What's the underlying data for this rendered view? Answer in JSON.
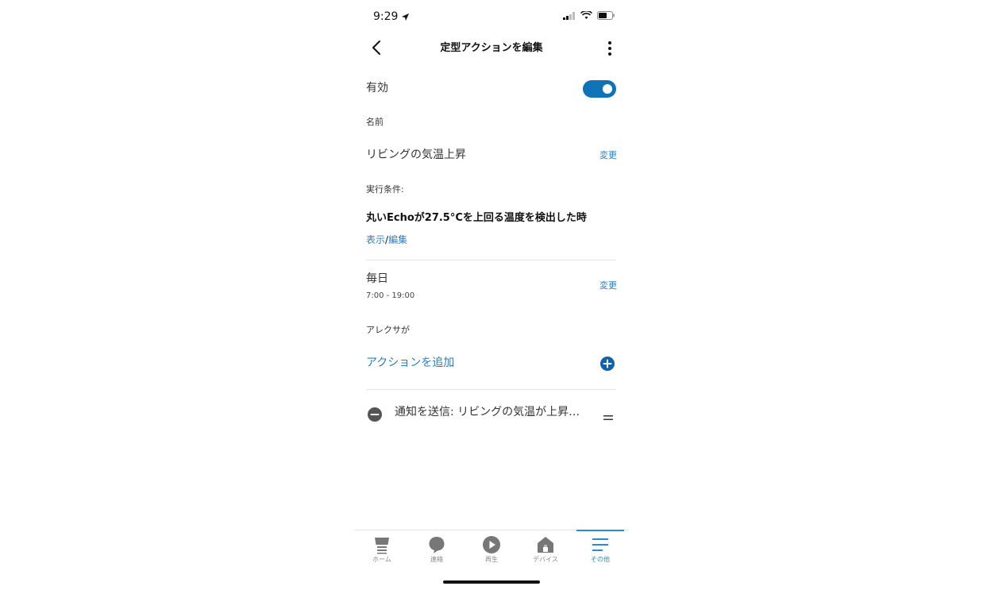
{
  "status_bar": {
    "time": "9:29"
  },
  "header": {
    "title": "定型アクションを編集"
  },
  "enabled": {
    "label": "有効",
    "on": true
  },
  "name_section": {
    "label": "名前",
    "value": "リビングの気温上昇",
    "change": "変更"
  },
  "condition": {
    "label": "実行条件:",
    "text": "丸いEchoが27.5°Cを上回る温度を検出した時",
    "view": "表示",
    "sep": "/",
    "edit": "編集"
  },
  "schedule": {
    "title": "毎日",
    "time": "7:00 - 19:00",
    "change": "変更"
  },
  "alexa": {
    "label": "アレクサが",
    "add_action": "アクションを追加"
  },
  "actions": [
    {
      "text": "通知を送信: リビングの気温が上昇…"
    }
  ],
  "tabbar": {
    "items": [
      {
        "label": "ホーム",
        "icon": "home-icon"
      },
      {
        "label": "連絡",
        "icon": "chat-bubble-icon"
      },
      {
        "label": "再生",
        "icon": "play-icon"
      },
      {
        "label": "デバイス",
        "icon": "devices-house-icon"
      },
      {
        "label": "その他",
        "icon": "menu-icon"
      }
    ],
    "active_index": 4
  },
  "colors": {
    "accent": "#0f73b8",
    "link": "#2b7ec0",
    "active_tab": "#2b8ad0"
  }
}
